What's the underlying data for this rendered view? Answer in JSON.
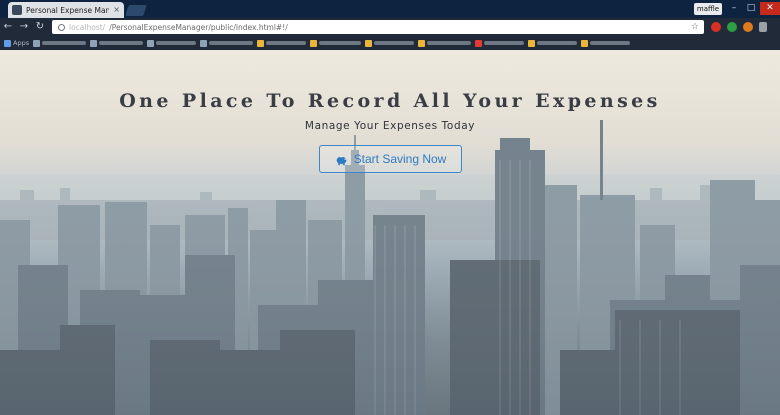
{
  "browser": {
    "tab_title": "Personal Expense Manag",
    "tab_close": "×",
    "profile": "maffle",
    "url_host": "localhost/",
    "url_path": "/PersonalExpenseManager/public/index.html#!/",
    "bookmarks": [
      {
        "label": "Apps",
        "icon": "apps-icon"
      },
      {
        "label": "",
        "icon": "bookmark-icon"
      },
      {
        "label": "",
        "icon": "bookmark-icon"
      },
      {
        "label": "",
        "icon": "bookmark-icon"
      },
      {
        "label": "",
        "icon": "bookmark-icon"
      },
      {
        "label": "",
        "icon": "folder-icon"
      },
      {
        "label": "",
        "icon": "folder-icon"
      },
      {
        "label": "",
        "icon": "folder-icon"
      },
      {
        "label": "",
        "icon": "folder-icon"
      },
      {
        "label": "",
        "icon": "youtube-icon"
      },
      {
        "label": "",
        "icon": "folder-icon"
      },
      {
        "label": "",
        "icon": "folder-icon"
      }
    ]
  },
  "hero": {
    "title": "One Place To Record All Your Expenses",
    "subtitle": "Manage Your Expenses Today",
    "cta_label": "Start Saving Now",
    "cta_icon": "piggy-bank-icon"
  },
  "colors": {
    "accent": "#2f7bc3",
    "title": "#3a3d44"
  }
}
